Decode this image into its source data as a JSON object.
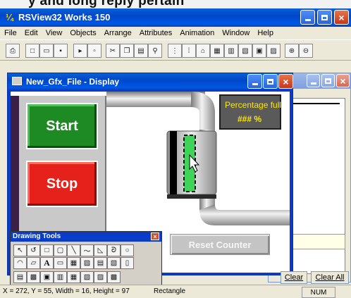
{
  "app": {
    "heading_fragment": "y and long reply pertain",
    "title": "RSView32 Works 150",
    "logo_glyph": "¼"
  },
  "menu": [
    "File",
    "Edit",
    "View",
    "Objects",
    "Arrange",
    "Attributes",
    "Animation",
    "Window",
    "Help"
  ],
  "toolbar_icons": [
    "print-icon",
    "new-icon",
    "open-icon",
    "save-icon",
    "run-icon",
    "test-icon",
    "cut-icon",
    "copy-icon",
    "paste-icon",
    "find-icon",
    "grid-icon",
    "snap-icon",
    "tag-icon",
    "library-icon",
    "grid2-icon",
    "align-icon",
    "group-icon",
    "ungroup-icon",
    "zoom-in-icon",
    "zoom-out-icon"
  ],
  "display": {
    "title": "New_Gfx_File - Display",
    "start_label": "Start",
    "stop_label": "Stop",
    "gauge_title": "Percentage full",
    "gauge_value": "###  %",
    "reset_label": "Reset Counter",
    "colors": {
      "start": "#1d8a23",
      "stop": "#e6201a",
      "gauge_text": "#ffe800",
      "tank_fill": "#3fd35a"
    }
  },
  "drawing_tools": {
    "title": "Drawing Tools",
    "row1": [
      "↖",
      "↺",
      "□",
      "▢",
      "╲",
      "〜",
      "◺",
      "ᘐ",
      "○"
    ],
    "row2": [
      "◠",
      "▱",
      "A",
      "▭",
      "▦",
      "▨",
      "▤",
      "▧",
      "▯"
    ],
    "row3": [
      "▤",
      "▩",
      "▣",
      "▥",
      "▦",
      "▧",
      "▨",
      "▩"
    ]
  },
  "buttons": {
    "clear": "Clear",
    "clear_all": "Clear All"
  },
  "status": {
    "coords": "X = 272, Y = 55, Width = 16, Height = 97",
    "object_type": "Rectangle",
    "num": "NUM"
  }
}
